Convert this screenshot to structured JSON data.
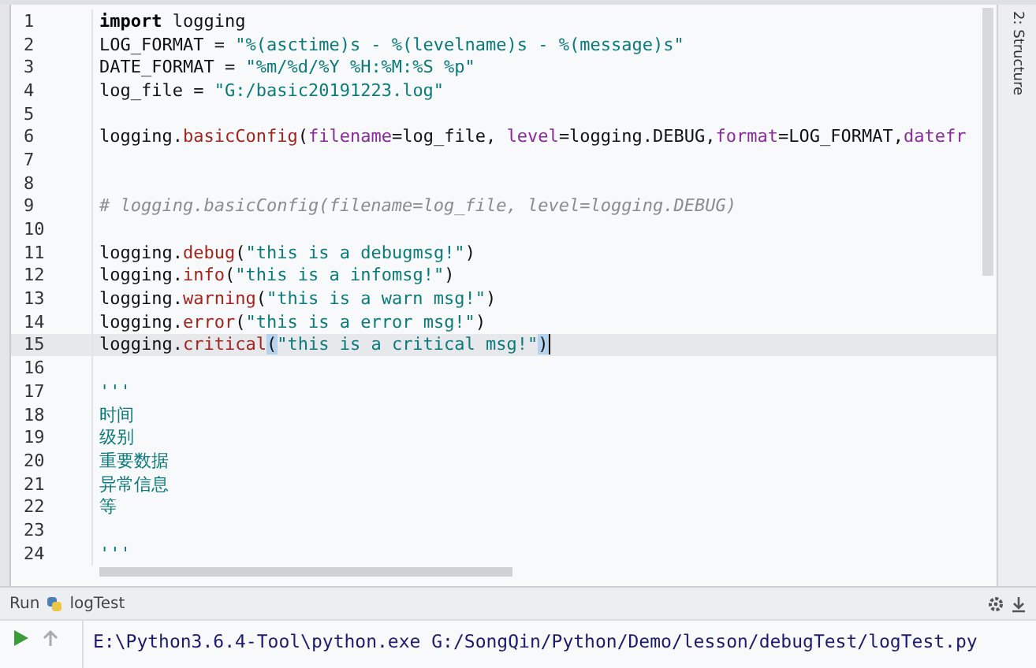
{
  "editor": {
    "lines": [
      {
        "number": "1",
        "current": false,
        "tokens": [
          {
            "kind": "keyword",
            "text": "import"
          },
          {
            "kind": "plain",
            "text": " logging"
          }
        ]
      },
      {
        "number": "2",
        "current": false,
        "tokens": [
          {
            "kind": "plain",
            "text": "LOG_FORMAT = "
          },
          {
            "kind": "string",
            "text": "\"%(asctime)s - %(levelname)s - %(message)s\""
          }
        ]
      },
      {
        "number": "3",
        "current": false,
        "tokens": [
          {
            "kind": "plain",
            "text": "DATE_FORMAT = "
          },
          {
            "kind": "string",
            "text": "\"%m/%d/%Y %H:%M:%S %p\""
          }
        ]
      },
      {
        "number": "4",
        "current": false,
        "tokens": [
          {
            "kind": "plain",
            "text": "log_file = "
          },
          {
            "kind": "string",
            "text": "\"G:/basic20191223.log\""
          }
        ]
      },
      {
        "number": "5",
        "current": false
      },
      {
        "number": "6",
        "current": false,
        "tokens": [
          {
            "kind": "plain",
            "text": "logging."
          },
          {
            "kind": "function",
            "text": "basicConfig"
          },
          {
            "kind": "plain",
            "text": "("
          },
          {
            "kind": "param",
            "text": "filename"
          },
          {
            "kind": "plain",
            "text": "=log_file, "
          },
          {
            "kind": "param",
            "text": "level"
          },
          {
            "kind": "plain",
            "text": "=logging.DEBUG,"
          },
          {
            "kind": "param",
            "text": "format"
          },
          {
            "kind": "plain",
            "text": "=LOG_FORMAT,"
          },
          {
            "kind": "param",
            "text": "datefr"
          }
        ]
      },
      {
        "number": "7",
        "current": false
      },
      {
        "number": "8",
        "current": false
      },
      {
        "number": "9",
        "current": false,
        "tokens": [
          {
            "kind": "comment",
            "text": "# logging.basicConfig(filename=log_file, level=logging.DEBUG)"
          }
        ]
      },
      {
        "number": "10",
        "current": false
      },
      {
        "number": "11",
        "current": false,
        "tokens": [
          {
            "kind": "plain",
            "text": "logging."
          },
          {
            "kind": "function",
            "text": "debug"
          },
          {
            "kind": "plain",
            "text": "("
          },
          {
            "kind": "string",
            "text": "\"this is a debugmsg!\""
          },
          {
            "kind": "plain",
            "text": ")"
          }
        ]
      },
      {
        "number": "12",
        "current": false,
        "tokens": [
          {
            "kind": "plain",
            "text": "logging."
          },
          {
            "kind": "function",
            "text": "info"
          },
          {
            "kind": "plain",
            "text": "("
          },
          {
            "kind": "string",
            "text": "\"this is a infomsg!\""
          },
          {
            "kind": "plain",
            "text": ")"
          }
        ]
      },
      {
        "number": "13",
        "current": false,
        "tokens": [
          {
            "kind": "plain",
            "text": "logging."
          },
          {
            "kind": "function",
            "text": "warning"
          },
          {
            "kind": "plain",
            "text": "("
          },
          {
            "kind": "string",
            "text": "\"this is a warn msg!\""
          },
          {
            "kind": "plain",
            "text": ")"
          }
        ]
      },
      {
        "number": "14",
        "current": false,
        "tokens": [
          {
            "kind": "plain",
            "text": "logging."
          },
          {
            "kind": "function",
            "text": "error"
          },
          {
            "kind": "plain",
            "text": "("
          },
          {
            "kind": "string",
            "text": "\"this is a error msg!\""
          },
          {
            "kind": "plain",
            "text": ")"
          }
        ]
      },
      {
        "number": "15",
        "current": true,
        "tokens": [
          {
            "kind": "plain",
            "text": "logging."
          },
          {
            "kind": "function",
            "text": "critical"
          },
          {
            "kind": "match",
            "text": "("
          },
          {
            "kind": "string",
            "text": "\"this is a critical msg!\""
          },
          {
            "kind": "match",
            "text": ")"
          }
        ]
      },
      {
        "number": "16",
        "current": false
      },
      {
        "number": "17",
        "current": false,
        "tokens": [
          {
            "kind": "string",
            "text": "'''"
          }
        ]
      },
      {
        "number": "18",
        "current": false,
        "tokens": [
          {
            "kind": "string",
            "text": "时间"
          }
        ]
      },
      {
        "number": "19",
        "current": false,
        "tokens": [
          {
            "kind": "string",
            "text": "级别"
          }
        ]
      },
      {
        "number": "20",
        "current": false,
        "tokens": [
          {
            "kind": "string",
            "text": "重要数据"
          }
        ]
      },
      {
        "number": "21",
        "current": false,
        "tokens": [
          {
            "kind": "string",
            "text": "异常信息"
          }
        ]
      },
      {
        "number": "22",
        "current": false,
        "tokens": [
          {
            "kind": "string",
            "text": "等"
          }
        ]
      },
      {
        "number": "23",
        "current": false
      },
      {
        "number": "24",
        "current": false,
        "tokens": [
          {
            "kind": "string",
            "text": "'''"
          }
        ]
      }
    ]
  },
  "side_panel": {
    "label": "2: Structure"
  },
  "run_panel": {
    "title": "Run",
    "config": "logTest",
    "command": "E:\\Python3.6.4-Tool\\python.exe G:/SongQin/Python/Demo/lesson/debugTest/logTest.py"
  }
}
